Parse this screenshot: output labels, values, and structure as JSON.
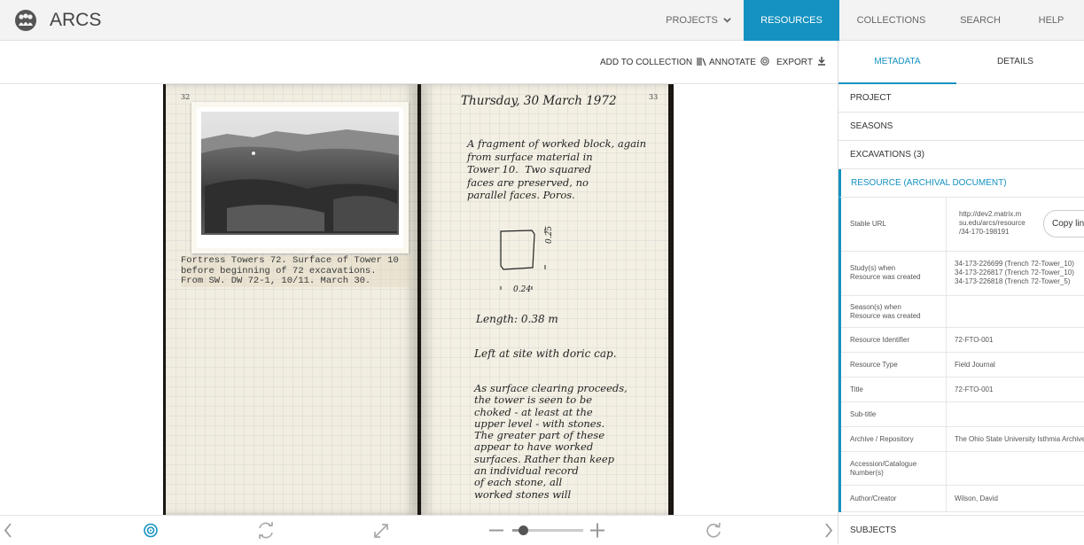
{
  "app": {
    "name": "ARCS"
  },
  "nav": [
    {
      "label": "PROJECTS"
    },
    {
      "label": "RESOURCES"
    },
    {
      "label": "COLLECTIONS"
    },
    {
      "label": "SEARCH"
    },
    {
      "label": "HELP"
    }
  ],
  "toolbar": {
    "add_to_collection": "ADD TO COLLECTION",
    "annotate": "ANNOTATE",
    "export": "EXPORT"
  },
  "document": {
    "left_page_number": "32",
    "right_page_number": "33",
    "caption": [
      "Fortress Towers 72. Surface of Tower 10",
      "before beginning of 72 excavations.",
      "From SW. DW 72-1, 10/11. March 30."
    ],
    "date_heading": "Thursday, 30 March 1972",
    "entry_lines": [
      "A fragment of worked block, again",
      "from surface material in",
      "Tower 10.  Two squared",
      "faces are preserved, no",
      "parallel faces. Poros."
    ],
    "dim_height": "0.25",
    "dim_width": "0.24",
    "length_note": "Length: 0.38 m",
    "note2": "Left at site with doric cap.",
    "note3_lines": [
      "As surface clearing proceeds,",
      "the tower is seen to be",
      "choked - at least at the",
      "upper level - with stones.",
      "The greater part of these",
      "appear to have worked",
      "surfaces. Rather than keep",
      "an individual record",
      "of each stone, all",
      "worked stones will"
    ]
  },
  "viewer_controls": {
    "zoom_level": 0.15
  },
  "sidebar": {
    "tabs": [
      {
        "label": "METADATA"
      },
      {
        "label": "DETAILS"
      }
    ],
    "sections": {
      "project": "PROJECT",
      "seasons": "SEASONS",
      "excavations": "EXCAVATIONS (3)",
      "resource": "RESOURCE (ARCHIVAL DOCUMENT)",
      "subjects": "SUBJECTS"
    },
    "copy_button": "Copy link",
    "fields": [
      {
        "label": [
          "Stable URL"
        ],
        "value": [
          "http://dev2.matrix.m",
          "su.edu/arcs/resource",
          "/34-170-198191"
        ]
      },
      {
        "label": [
          "Study(s) when",
          "Resource was created"
        ],
        "value": [
          "34-173-226699 (Trench 72-Tower_10)",
          "34-173-226817 (Trench 72-Tower_10)",
          "34-173-226818 (Trench 72-Tower_5)"
        ]
      },
      {
        "label": [
          "Season(s) when",
          "Resource was created"
        ],
        "value": []
      },
      {
        "label": [
          "Resource Identifier"
        ],
        "value": [
          "72-FTO-001"
        ]
      },
      {
        "label": [
          "Resource Type"
        ],
        "value": [
          "Field Journal"
        ]
      },
      {
        "label": [
          "Title"
        ],
        "value": [
          "72-FTO-001"
        ]
      },
      {
        "label": [
          "Sub-title"
        ],
        "value": []
      },
      {
        "label": [
          "Archive / Repository"
        ],
        "value": [
          "The Ohio State University Isthmia Archives"
        ]
      },
      {
        "label": [
          "Accession/Catalogue",
          "Number(s)"
        ],
        "value": []
      },
      {
        "label": [
          "Author/Creator"
        ],
        "value": [
          "Wilson, David"
        ]
      }
    ]
  },
  "colors": {
    "accent": "#1592c1",
    "topbar_bg": "#f3f3f3",
    "paper": "#f3eee2"
  }
}
